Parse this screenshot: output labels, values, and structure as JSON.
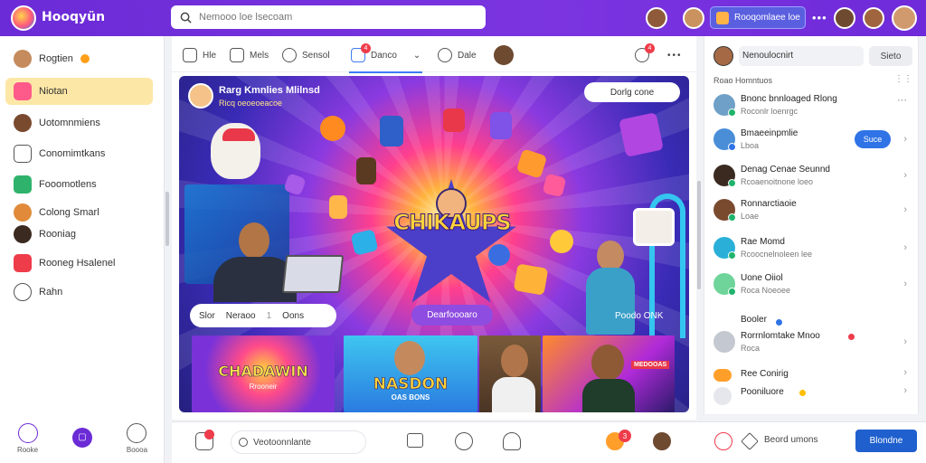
{
  "topbar": {
    "brand": "Hooqyün",
    "search_placeholder": "Nemooo loe lsecoam",
    "pill_label": "Rooqomlaee loe",
    "menu_dots": "•••"
  },
  "leftnav": {
    "items": [
      {
        "label": "Rogtien",
        "icon": "user-avatar-icon"
      },
      {
        "label": "Niotan",
        "icon": "user-avatar-icon"
      },
      {
        "label": "Uotomnmiens",
        "icon": "user-avatar-icon"
      },
      {
        "label": "Conomimtkans",
        "icon": "store-icon"
      },
      {
        "label": "Fooomotlens",
        "icon": "app-icon"
      },
      {
        "label": "Colong Smarl",
        "icon": "user-avatar-icon"
      },
      {
        "label": "Rooniag",
        "icon": "user-avatar-icon"
      },
      {
        "label": "Rooneg Hsalenel",
        "icon": "app-icon"
      },
      {
        "label": "Rahn",
        "icon": "chat-icon"
      }
    ],
    "bottom": [
      {
        "label": "Rooke",
        "icon": "home-icon"
      },
      {
        "label": "",
        "icon": "add-icon"
      },
      {
        "label": "Boooa",
        "icon": "circle-icon"
      }
    ]
  },
  "tabs": [
    {
      "label": "Hle",
      "icon": "home-icon"
    },
    {
      "label": "Mels",
      "icon": "gift-icon"
    },
    {
      "label": "Sensol",
      "icon": "puzzle-icon"
    },
    {
      "label": "Danco",
      "icon": "gamepad-icon",
      "badge": "4"
    },
    {
      "label": "Dale",
      "icon": "smiley-icon"
    }
  ],
  "tab_right_badge": "4",
  "hero": {
    "title": "Rarg Kmnlies Mlilnsd",
    "subtitle": "Ricq oeoeoeacoe",
    "top_button": "Dorlg cone",
    "logo_text": "CHIKAUPS",
    "control_labels": [
      "Slor",
      "Neraoo",
      "1",
      "Oons"
    ],
    "cta": "Dearfoooaro",
    "overlay_tag": "Poodo ONK"
  },
  "thumbs": [
    {
      "title": "CHADAWIN",
      "kicker": "Rrooneir"
    },
    {
      "title": "NASDON",
      "kicker": "OAS BONS"
    },
    {
      "title": "",
      "kicker": ""
    },
    {
      "title": "",
      "kicker": "MEDOOAS"
    }
  ],
  "right": {
    "header_label": "Nenoulocnirt",
    "header_button": "Sieto",
    "section_label": "Roao Homntuos",
    "items": [
      {
        "title": "Bnonc bnnloaged Rlong",
        "sub": "Roconlr loenrgc",
        "dot": "#1fb36c"
      },
      {
        "title": "Bmaeeinpmlie",
        "sub": "Lboa",
        "button": "Suce",
        "dot": "#2f73e6"
      },
      {
        "title": "Denag Cenae Seunnd",
        "sub": "Rcoaenoitnone loeo",
        "dot": "#1fb36c"
      },
      {
        "title": "Ronnarctiaoie",
        "sub": "Loae",
        "dot": "#1fb36c"
      },
      {
        "title": "Rae Momd",
        "sub": "Rcoocnelnoleen lee",
        "dot": "#1fb36c"
      },
      {
        "title": "Uone Oiiol",
        "sub": "Roca Noeoee",
        "dot": "#1fb36c"
      },
      {
        "title": "Booler",
        "sub": "",
        "dot": "#2f73e6"
      },
      {
        "title": "Rorrnlomtake Mnoo",
        "sub": "Roca",
        "dot": "#ef3c4a"
      },
      {
        "title": "Ree Conirig",
        "sub": "",
        "dot": "#ff9f2a"
      },
      {
        "title": "Pooniluore",
        "sub": "",
        "dot": "#ffbf00"
      }
    ]
  },
  "bottombar": {
    "search_placeholder": "Veotoonnlante",
    "notif_count": "3",
    "right_label": "Beord umons",
    "button": "Blondne"
  }
}
